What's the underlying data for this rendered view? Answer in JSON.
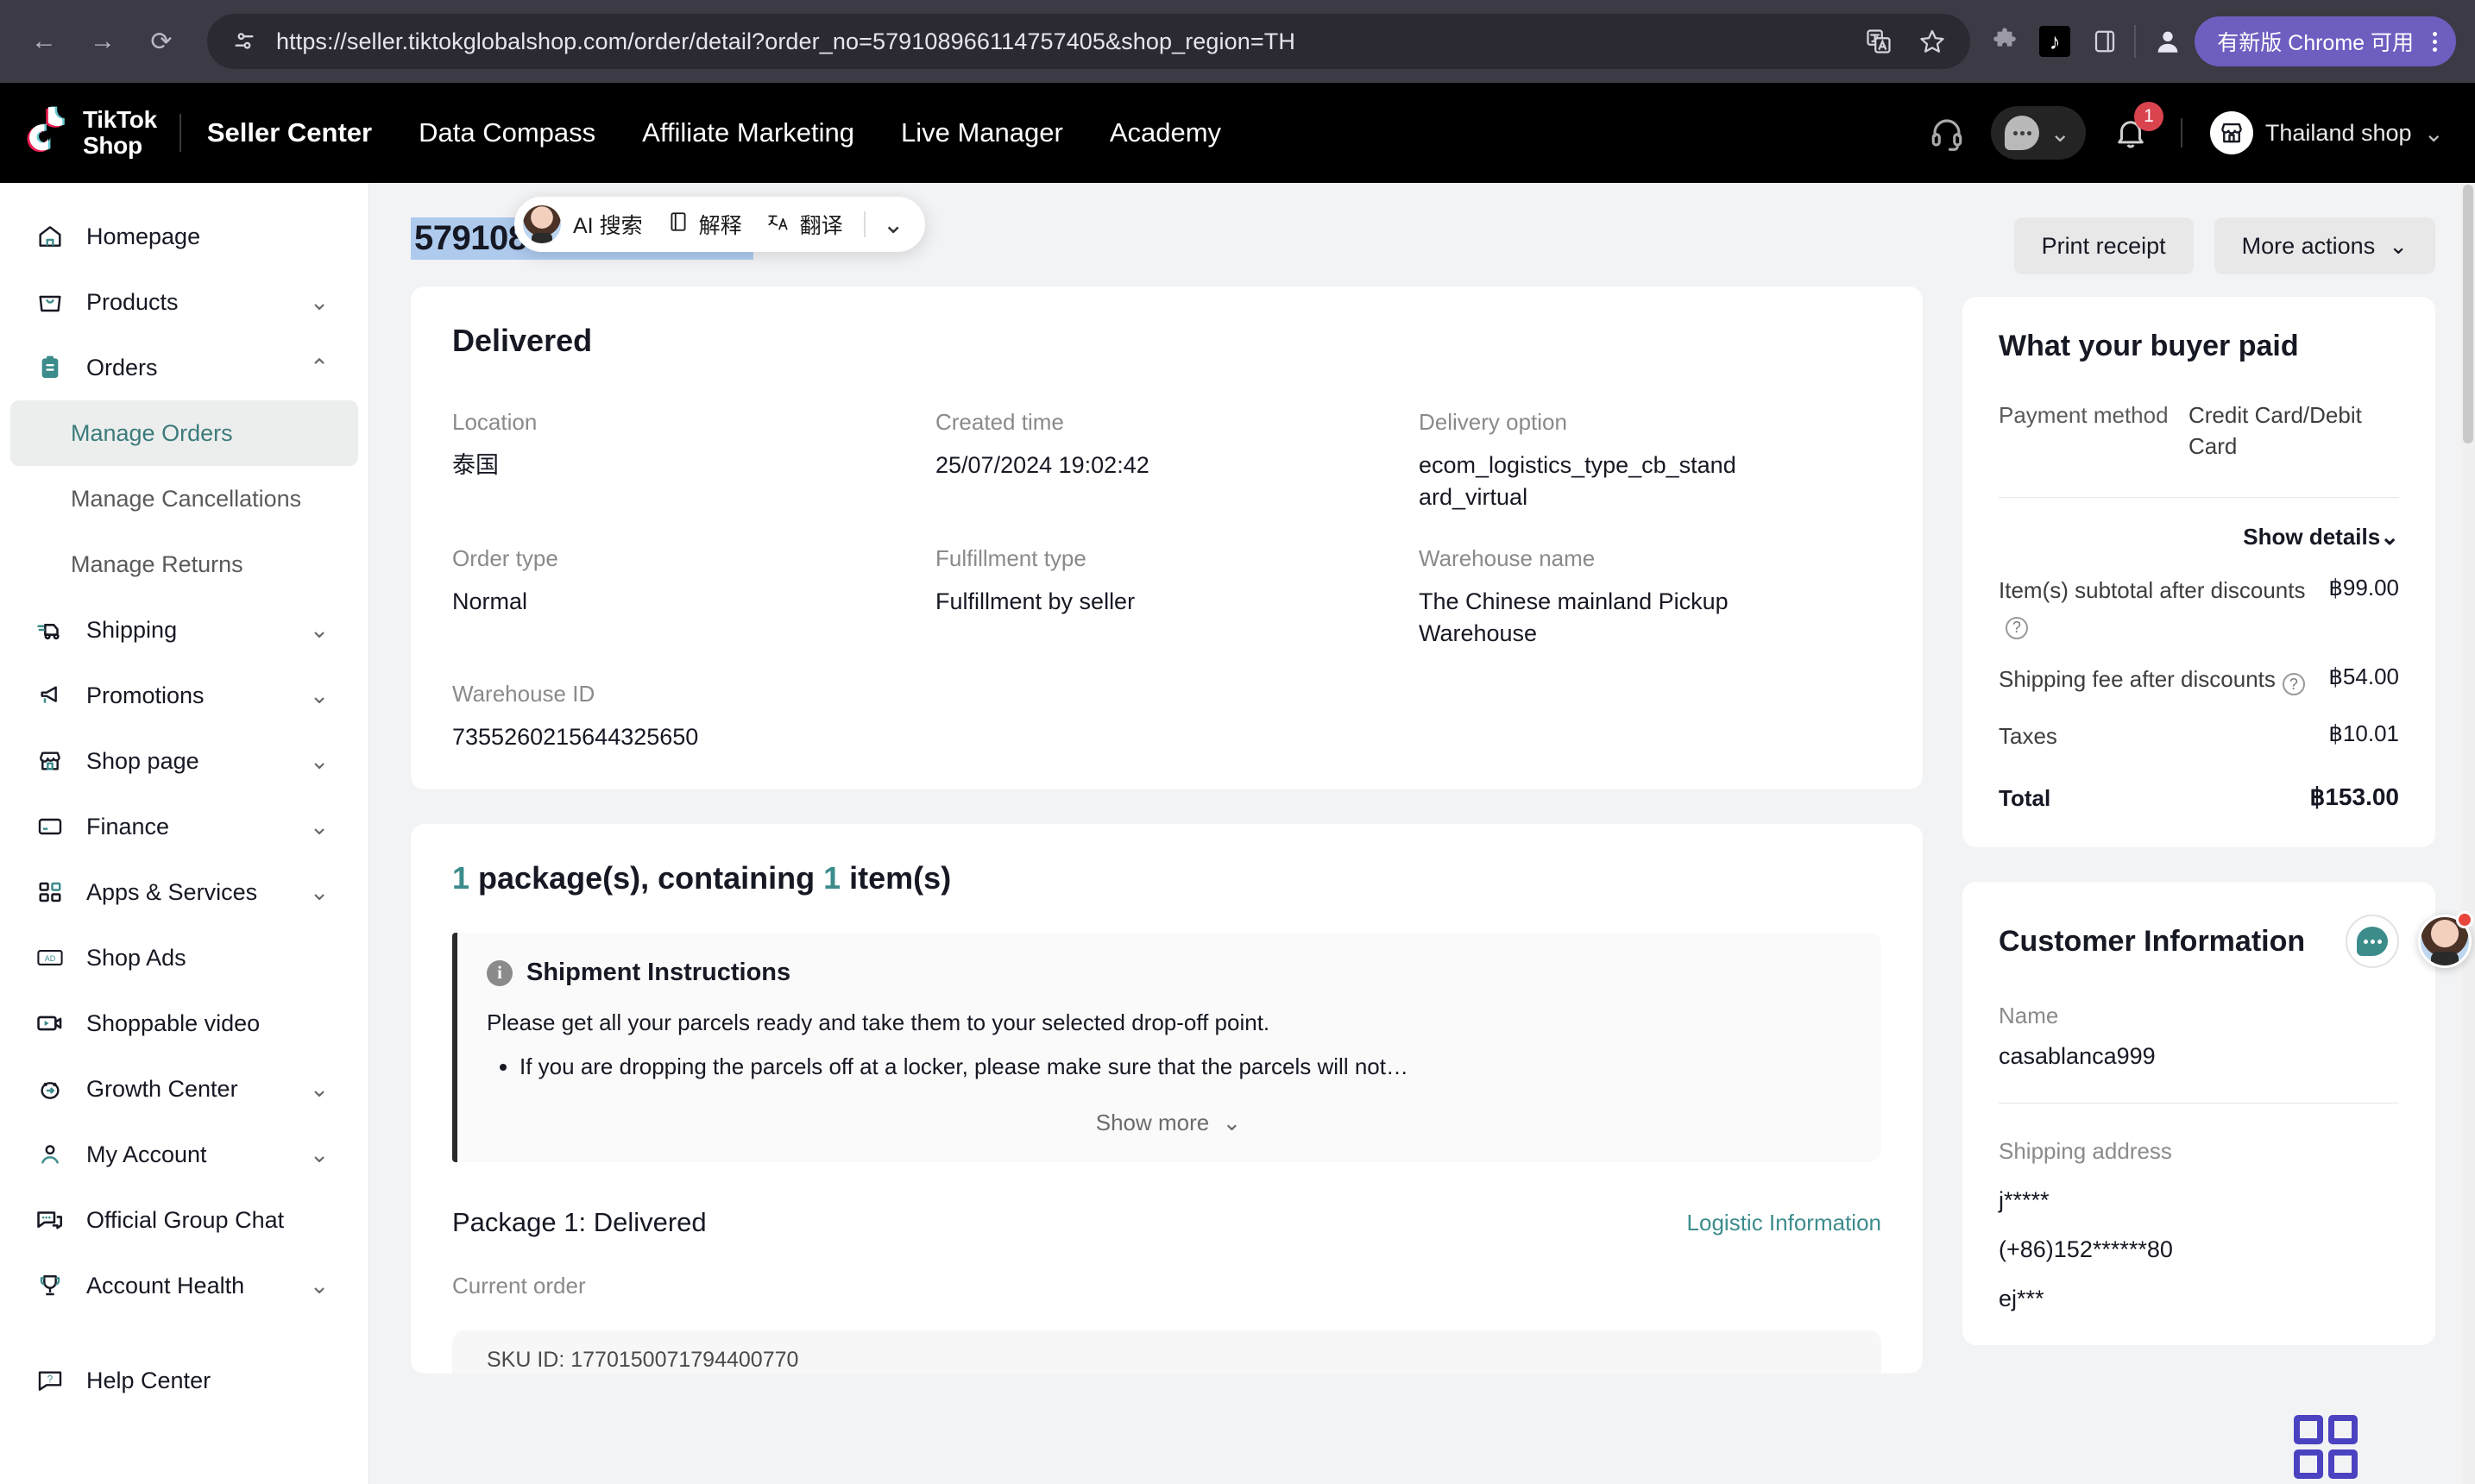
{
  "browser": {
    "url": "https://seller.tiktokglobalshop.com/order/detail?order_no=579108966114757405&shop_region=TH",
    "back_icon": "←",
    "forward_icon": "→",
    "reload_icon": "⟳",
    "site_info_icon": "tune-icon",
    "translate_icon": "translate-icon",
    "bookmark_icon": "star-icon",
    "extension_icon": "puzzle-icon",
    "tiktok_ext_icon": "tiktok-icon",
    "sidepanel_icon": "side-panel-icon",
    "profile_icon": "profile-icon",
    "update_label": "有新版 Chrome 可用",
    "menu_icon": "kebab-menu-icon"
  },
  "topnav": {
    "logo_line1": "TikTok",
    "logo_line2": "Shop",
    "links": [
      {
        "label": "Seller Center",
        "bold": true
      },
      {
        "label": "Data Compass",
        "bold": false
      },
      {
        "label": "Affiliate Marketing",
        "bold": false
      },
      {
        "label": "Live Manager",
        "bold": false
      },
      {
        "label": "Academy",
        "bold": false
      }
    ],
    "support_icon": "headset-icon",
    "message_icon": "message-bubble-icon",
    "message_chevron": "⌄",
    "notification_icon": "bell-icon",
    "notification_count": "1",
    "shop_icon": "storefront-icon",
    "shop_name": "Thailand shop",
    "shop_chevron": "⌄"
  },
  "sidebar": {
    "items": [
      {
        "label": "Homepage",
        "icon": "home-icon",
        "chevron": "",
        "name": "homepage"
      },
      {
        "label": "Products",
        "icon": "box-icon",
        "chevron": "⌄",
        "name": "products"
      },
      {
        "label": "Orders",
        "icon": "clipboard-icon",
        "chevron": "⌃",
        "name": "orders",
        "active_parent": true
      }
    ],
    "order_subitems": [
      {
        "label": "Manage Orders",
        "active": true,
        "name": "manage-orders"
      },
      {
        "label": "Manage Cancellations",
        "active": false,
        "name": "manage-cancellations"
      },
      {
        "label": "Manage Returns",
        "active": false,
        "name": "manage-returns"
      }
    ],
    "items2": [
      {
        "label": "Shipping",
        "icon": "truck-icon",
        "chevron": "⌄",
        "name": "shipping"
      },
      {
        "label": "Promotions",
        "icon": "megaphone-icon",
        "chevron": "⌄",
        "name": "promotions"
      },
      {
        "label": "Shop page",
        "icon": "storefront-icon",
        "chevron": "⌄",
        "name": "shop-page"
      },
      {
        "label": "Finance",
        "icon": "card-icon",
        "chevron": "⌄",
        "name": "finance"
      },
      {
        "label": "Apps & Services",
        "icon": "grid-icon",
        "chevron": "⌄",
        "name": "apps-services"
      },
      {
        "label": "Shop Ads",
        "icon": "ad-icon",
        "chevron": "",
        "name": "shop-ads"
      },
      {
        "label": "Shoppable video",
        "icon": "video-icon",
        "chevron": "",
        "name": "shoppable-video"
      },
      {
        "label": "Growth Center",
        "icon": "growth-icon",
        "chevron": "⌄",
        "name": "growth-center"
      },
      {
        "label": "My Account",
        "icon": "person-icon",
        "chevron": "⌄",
        "name": "my-account"
      },
      {
        "label": "Official Group Chat",
        "icon": "chat-icon",
        "chevron": "",
        "name": "official-group-chat"
      },
      {
        "label": "Account Health",
        "icon": "trophy-icon",
        "chevron": "⌄",
        "name": "account-health"
      }
    ],
    "help": {
      "label": "Help Center",
      "icon": "help-chat-icon",
      "name": "help-center"
    }
  },
  "ai_popup": {
    "avatar_icon": "ai-avatar-icon",
    "search_label": "AI 搜索",
    "explain_icon": "book-icon",
    "explain_label": "解释",
    "translate_icon": "translate-text-icon",
    "translate_label": "翻译",
    "expand_chevron": "⌄"
  },
  "order": {
    "order_no": "579108966114757405",
    "print_receipt": "Print receipt",
    "more_actions": "More actions",
    "more_actions_chevron": "⌄",
    "status": "Delivered",
    "fields": [
      {
        "label": "Location",
        "value": "泰国"
      },
      {
        "label": "Created time",
        "value": "25/07/2024 19:02:42"
      },
      {
        "label": "Delivery option",
        "value": "ecom_logistics_type_cb_standard_virtual"
      },
      {
        "label": "Order type",
        "value": "Normal"
      },
      {
        "label": "Fulfillment type",
        "value": "Fulfillment by seller"
      },
      {
        "label": "Warehouse name",
        "value": "The Chinese mainland Pickup Warehouse"
      },
      {
        "label": "Warehouse ID",
        "value": "7355260215644325650"
      }
    ]
  },
  "packages": {
    "count": "1",
    "heading_mid": " package(s), containing ",
    "items_count": "1",
    "heading_end": " item(s)",
    "notice_title": "Shipment Instructions",
    "notice_info_icon": "info-icon",
    "notice_p1": "Please get all your parcels ready and take them to your selected drop-off point.",
    "notice_li1": "If you are dropping the parcels off at a locker, please make sure that the parcels will not…",
    "show_more": "Show more",
    "show_more_chevron": "⌄",
    "package_heading": "Package 1: Delivered",
    "logistic_link": "Logistic Information",
    "current_order": "Current order",
    "sku_line": "SKU ID: 1770150071794400770"
  },
  "buyer_paid": {
    "title": "What your buyer paid",
    "payment_method_label": "Payment method",
    "payment_method_value": "Credit Card/Debit Card",
    "show_details": "Show details",
    "show_details_chevron": "⌄",
    "rows": [
      {
        "label": "Item(s) subtotal after discounts",
        "help": true,
        "value": "฿99.00",
        "bold": false
      },
      {
        "label": "Shipping fee after discounts",
        "help": true,
        "value": "฿54.00",
        "bold": false
      },
      {
        "label": "Taxes",
        "help": false,
        "value": "฿10.01",
        "bold": false
      },
      {
        "label": "Total",
        "help": false,
        "value": "฿153.00",
        "bold": true
      }
    ]
  },
  "customer": {
    "title": "Customer Information",
    "chat_icon": "chat-bubble-icon",
    "name_label": "Name",
    "name_value": "casablanca999",
    "address_label": "Shipping address",
    "address_lines": [
      "j*****",
      "(+86)152******80",
      "ej***"
    ]
  },
  "floating": {
    "assistant_icon": "assistant-avatar-icon",
    "qr_icon": "qr-grid-icon"
  },
  "colors": {
    "teal": "#3d8c8c",
    "purple": "#6d5ec0",
    "red_badge": "#d9444f",
    "selection_blue": "#aecbee"
  }
}
